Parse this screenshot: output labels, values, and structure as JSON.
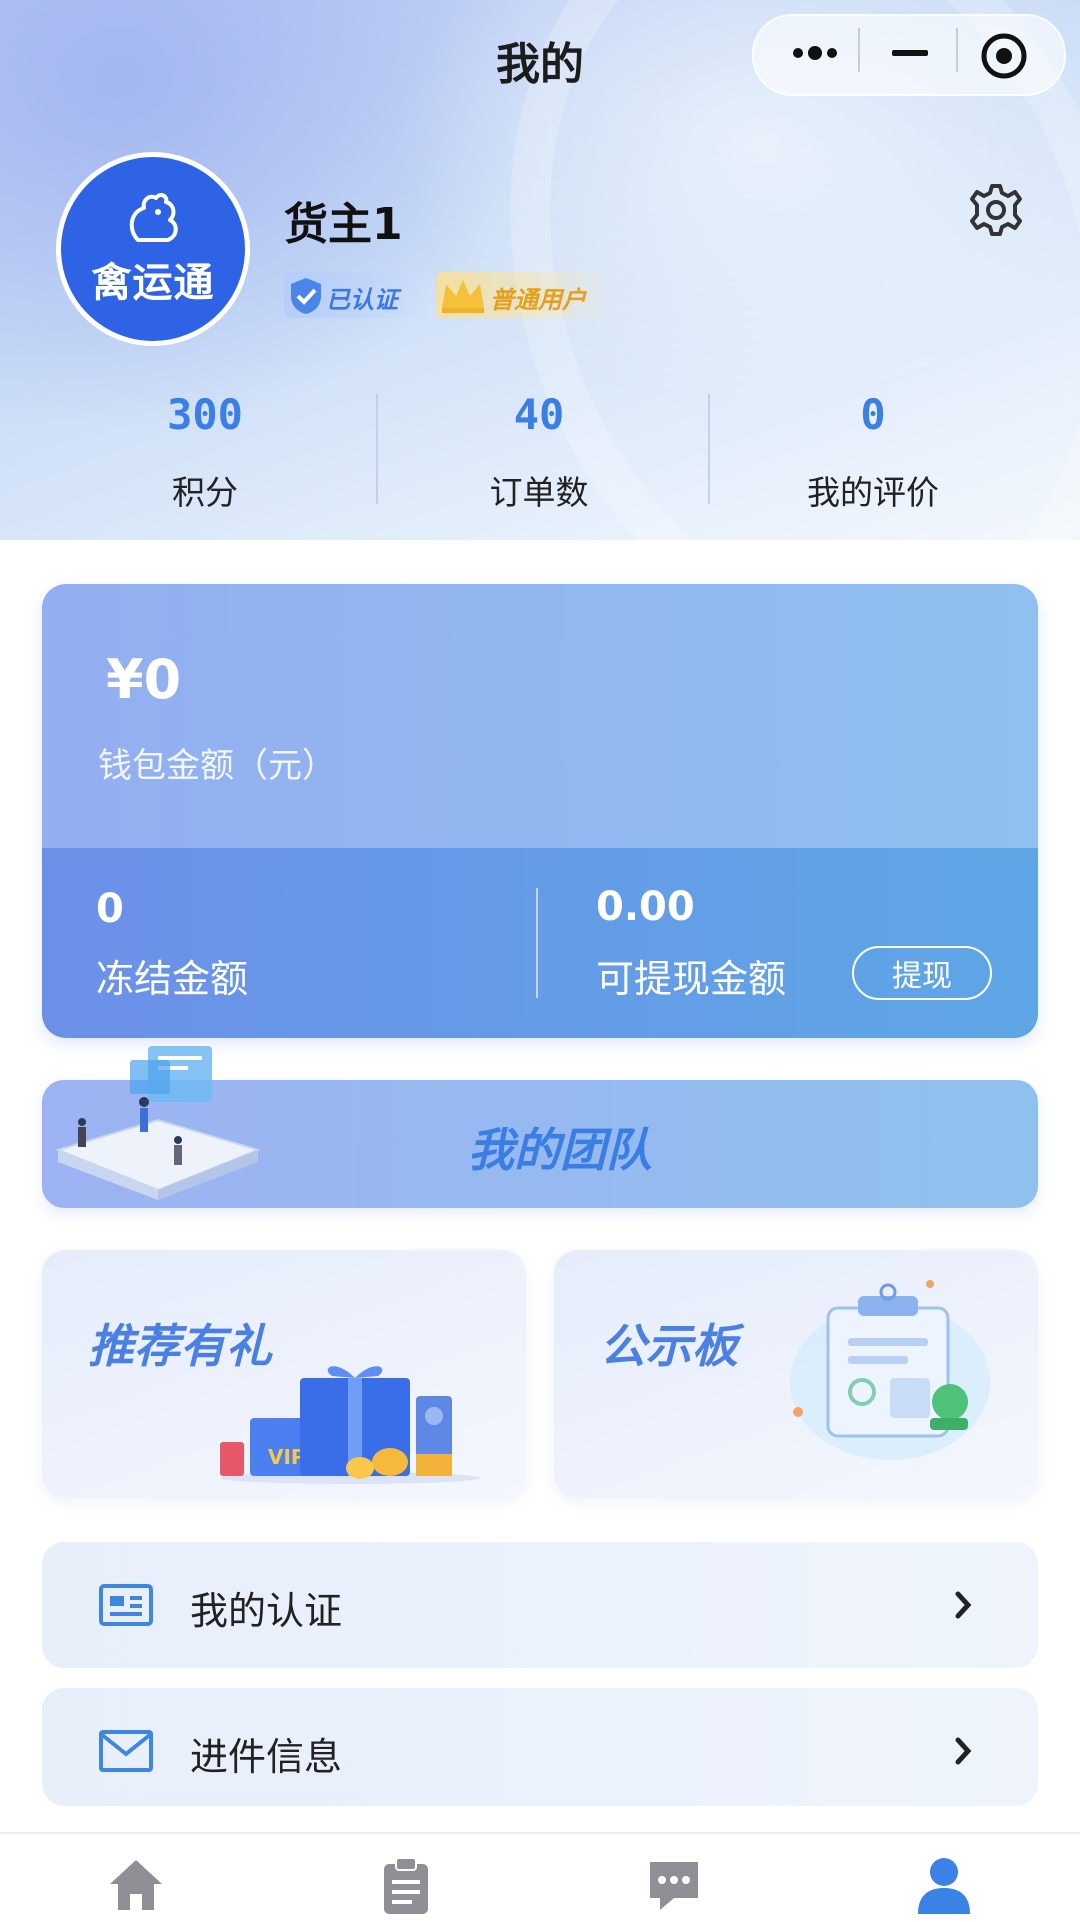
{
  "nav": {
    "title": "我的"
  },
  "profile": {
    "avatar_text": "禽运通",
    "username": "货主1",
    "badges": {
      "verified": "已认证",
      "level": "普通用户"
    }
  },
  "stats": [
    {
      "value": "300",
      "label": "积分"
    },
    {
      "value": "40",
      "label": "订单数"
    },
    {
      "value": "0",
      "label": "我的评价"
    }
  ],
  "wallet": {
    "total": "¥0",
    "total_label": "钱包金额（元）",
    "frozen_value": "0",
    "frozen_label": "冻结金额",
    "available_value": "0.00",
    "available_label": "可提现金额",
    "withdraw_button": "提现"
  },
  "team": {
    "label": "我的团队"
  },
  "cards": {
    "referral": "推荐有礼",
    "notice": "公示板",
    "gift_tag": "VIP"
  },
  "menu": [
    {
      "label": "我的认证",
      "icon": "id-card-icon"
    },
    {
      "label": "进件信息",
      "icon": "mail-icon"
    }
  ],
  "tabbar": {
    "items": [
      "home-icon",
      "clipboard-icon",
      "chat-icon",
      "user-icon"
    ],
    "active": "user-icon",
    "active_color": "#3b82e6",
    "inactive_color": "#8e9096"
  },
  "colors": {
    "accent": "#3b7fe6",
    "avatar_bg": "#2f63e6"
  }
}
